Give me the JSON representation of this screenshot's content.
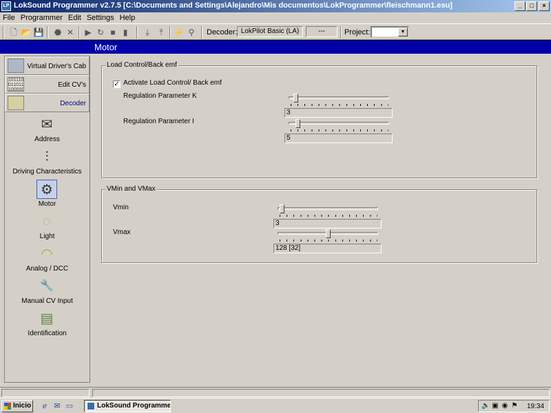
{
  "window": {
    "title": "LokSound Programmer  v2.7.5  [C:\\Documents and Settings\\Alejandro\\Mis documentos\\LokProgrammer\\fleischmann1.esu]",
    "app_icon_text": "LP",
    "minimize": "_",
    "maximize": "□",
    "close": "×"
  },
  "menu": [
    "File",
    "Programmer",
    "Edit",
    "Settings",
    "Help"
  ],
  "toolbar": {
    "decoder_label": "Decoder:",
    "decoder_value": "LokPilot Basic (LA)",
    "decoder_extra": "---",
    "project_label": "Project:",
    "project_value": ""
  },
  "header": {
    "title": "Motor"
  },
  "sidebar": {
    "tabs": [
      {
        "label": "Virtual Driver's Cab",
        "icon": "train-icon"
      },
      {
        "label": "Edit CV's",
        "icon": "binary-grid-icon",
        "icon_text": "101110 011011 100000 111010"
      },
      {
        "label": "Decoder",
        "icon": "decoder-chip-icon",
        "active": true
      }
    ],
    "tools": [
      {
        "label": "Address",
        "icon": "envelope-icon",
        "glyph": "✉"
      },
      {
        "label": "Driving Characteristics",
        "icon": "sliders-icon",
        "glyph": "⫶"
      },
      {
        "label": "Motor",
        "icon": "piston-icon",
        "glyph": "⚙",
        "selected": true
      },
      {
        "label": "Light",
        "icon": "bulb-icon",
        "glyph": "◌"
      },
      {
        "label": "Analog / DCC",
        "icon": "gauge-icon",
        "glyph": "◠"
      },
      {
        "label": "Manual CV Input",
        "icon": "wrench-icon",
        "glyph": "🔧"
      },
      {
        "label": "Identification",
        "icon": "id-card-icon",
        "glyph": "▤"
      }
    ]
  },
  "load_control": {
    "group_title": "Load Control/Back emf",
    "activate_label": "Activate Load Control/ Back emf",
    "activate_checked": "✓",
    "param_k_label": "Regulation Parameter K",
    "param_k_value": "3",
    "param_k_fraction": 0.05,
    "param_i_label": "Regulation Parameter I",
    "param_i_value": "5",
    "param_i_fraction": 0.07
  },
  "vmin_vmax": {
    "group_title": "VMin and VMax",
    "vmin_label": "Vmin",
    "vmin_value": "3",
    "vmin_fraction": 0.02,
    "vmax_label": "Vmax",
    "vmax_value": "128   [32]",
    "vmax_fraction": 0.5
  },
  "taskbar": {
    "start_label": "Inicio",
    "task_label": "LokSound Programme...",
    "clock": "19:34"
  }
}
